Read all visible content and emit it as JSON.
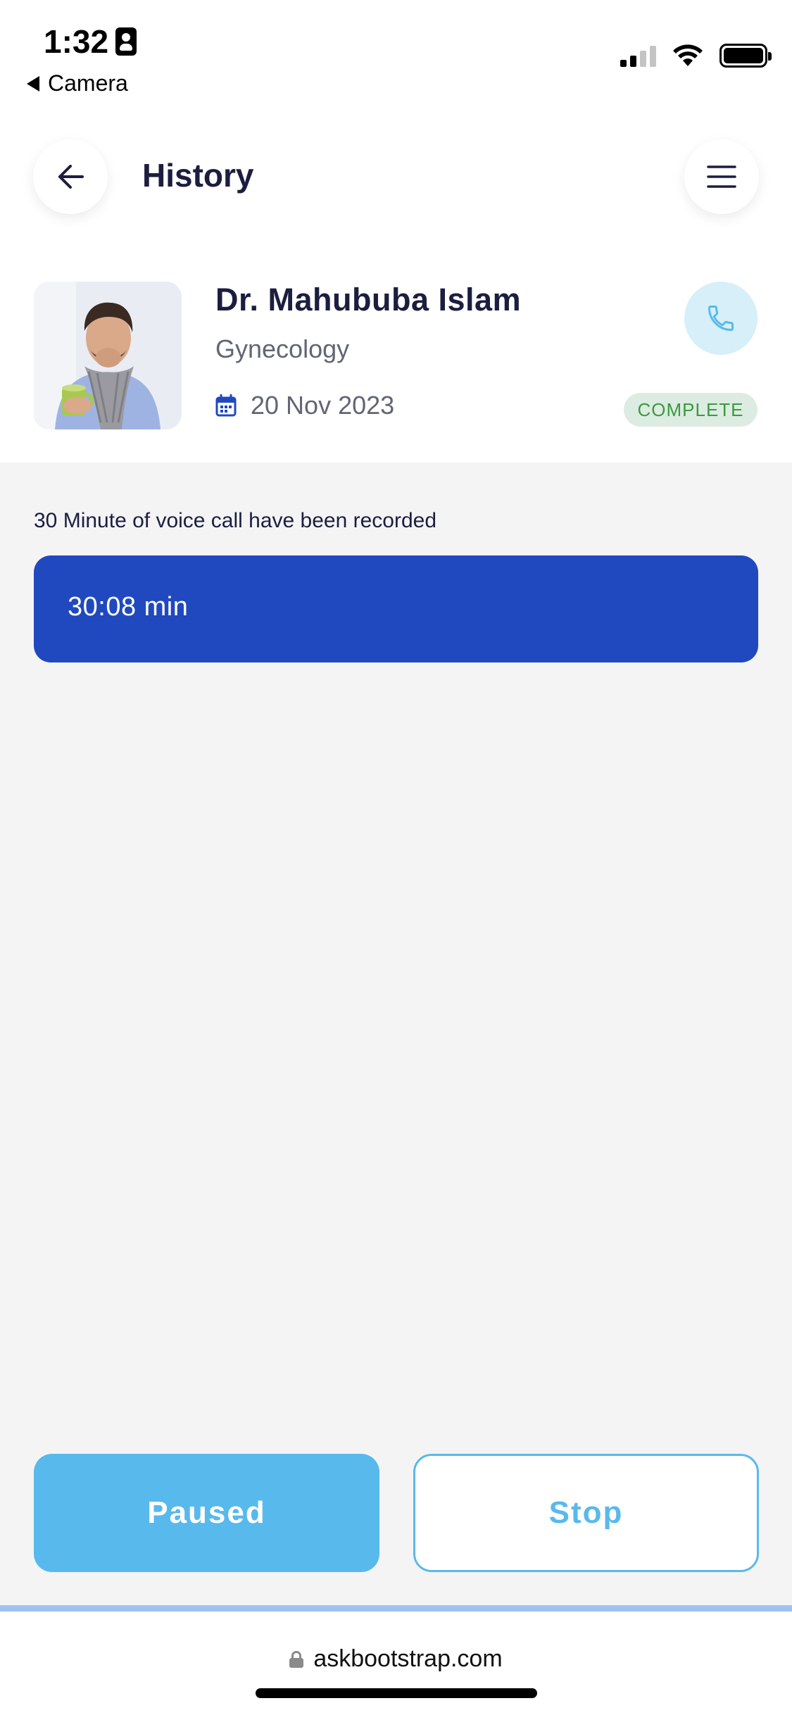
{
  "status_bar": {
    "time": "1:32",
    "back_app": "Camera"
  },
  "header": {
    "title": "History",
    "back_icon": "arrow-left-icon",
    "menu_icon": "hamburger-menu-icon"
  },
  "doctor": {
    "name": "Dr. Mahububa Islam",
    "specialty": "Gynecology",
    "date": "20 Nov 2023",
    "status": "COMPLETE",
    "call_icon": "phone-icon"
  },
  "recording": {
    "note": "30 Minute of voice call have been recorded",
    "duration": "30:08 min"
  },
  "actions": {
    "paused_label": "Paused",
    "stop_label": "Stop"
  },
  "browser": {
    "url": "askbootstrap.com"
  },
  "colors": {
    "primary_dark": "#2049bf",
    "accent_blue": "#58b9ec",
    "title_text": "#1c1e3f",
    "status_green": "#3c9a3e",
    "background": "#f4f4f5"
  }
}
